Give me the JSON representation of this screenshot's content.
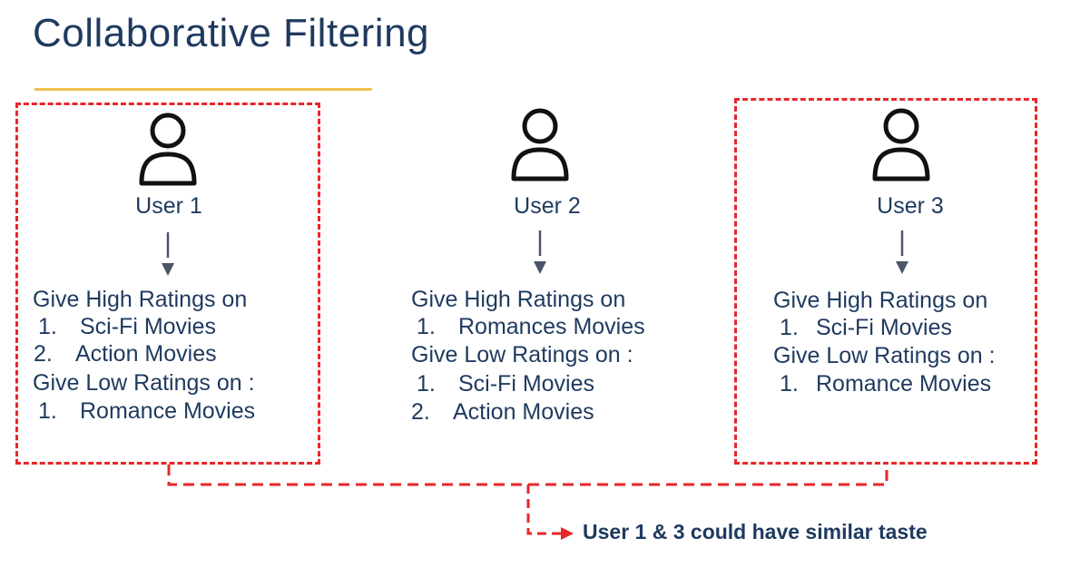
{
  "title": "Collaborative Filtering",
  "colors": {
    "title": "#1f3a5f",
    "underline": "#f2c14e",
    "dashed_highlight": "#e8262a",
    "arrow": "#4a5568"
  },
  "users": [
    {
      "label": "User 1",
      "icon": "user-icon",
      "high_heading": "Give High Ratings on",
      "high_items": [
        {
          "num": "1.",
          "text": "Sci-Fi Movies"
        },
        {
          "num": "2.",
          "text": "Action Movies"
        }
      ],
      "low_heading": "Give Low Ratings on :",
      "low_items": [
        {
          "num": "1.",
          "text": "Romance Movies"
        }
      ]
    },
    {
      "label": "User 2",
      "icon": "user-icon",
      "high_heading": "Give High Ratings on",
      "high_items": [
        {
          "num": "1.",
          "text": "Romances Movies"
        }
      ],
      "low_heading": "Give Low Ratings on :",
      "low_items": [
        {
          "num": "1.",
          "text": "Sci-Fi Movies"
        },
        {
          "num": "2.",
          "text": "Action Movies"
        }
      ]
    },
    {
      "label": "User 3",
      "icon": "user-icon",
      "high_heading": "Give High Ratings on",
      "high_items": [
        {
          "num": "1.",
          "text": "Sci-Fi Movies"
        }
      ],
      "low_heading": "Give Low Ratings on :",
      "low_items": [
        {
          "num": "1.",
          "text": "Romance Movies"
        }
      ]
    }
  ],
  "conclusion": "User 1 & 3 could have similar taste"
}
